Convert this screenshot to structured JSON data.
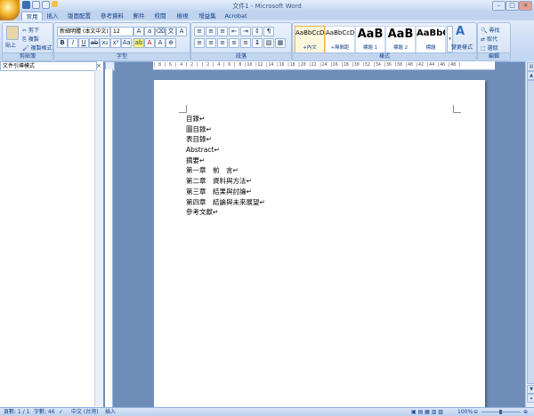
{
  "window": {
    "title": "文件1 - Microsoft Word"
  },
  "tabs": [
    {
      "label": "常用"
    },
    {
      "label": "插入"
    },
    {
      "label": "版面配置"
    },
    {
      "label": "參考資料"
    },
    {
      "label": "郵件"
    },
    {
      "label": "校閱"
    },
    {
      "label": "檢視"
    },
    {
      "label": "增益集"
    },
    {
      "label": "Acrobat"
    }
  ],
  "clipboard": {
    "paste_label": "貼上",
    "cut_label": "剪下",
    "copy_label": "複製",
    "format_painter_label": "複製格式",
    "group_label": "剪貼簿"
  },
  "font": {
    "name": "新細明體 (本文中文)",
    "size": "12",
    "group_label": "字型"
  },
  "paragraph": {
    "group_label": "段落"
  },
  "styles": {
    "items": [
      {
        "sample": "AaBbCcD",
        "name": "+內文"
      },
      {
        "sample": "AaBbCcD",
        "name": "+無間距"
      },
      {
        "sample": "AaB",
        "name": "標題 1"
      },
      {
        "sample": "AaB",
        "name": "標題 2"
      },
      {
        "sample": "AaBbC",
        "name": "標題"
      }
    ],
    "change_styles_label": "變更樣式",
    "group_label": "樣式"
  },
  "editing": {
    "find_label": "尋找",
    "replace_label": "取代",
    "select_label": "選取",
    "group_label": "編輯"
  },
  "ruler": {
    "text": "| 8 | 6 | 4 | 2 | | 2 | 4 | 6 | 8 |10 |12 |14 |16 |18 |20 |22 |24 |26 |28 |30 |32 |34 |36 |38 |40 |42 |44 |46 |48 |"
  },
  "doc_map": {
    "mode": "文件引導模式"
  },
  "document": {
    "lines": [
      "目錄↵",
      "圖目錄↵",
      "表目錄↵",
      "Abstract↵",
      "摘要↵",
      "第一章　前　言↵",
      "第二章　資料與方法↵",
      "第三章　結果與討論↵",
      "第四章　結論與未來展望↵",
      "參考文獻↵"
    ]
  },
  "status": {
    "page": "頁數: 1 / 1",
    "words": "字數: 46",
    "language": "中文 (台灣)",
    "mode": "插入",
    "zoom": "100%"
  },
  "colors": {
    "ribbon": "#c8daf3",
    "tab_text": "#15428b",
    "workspace": "#6f8db9"
  }
}
